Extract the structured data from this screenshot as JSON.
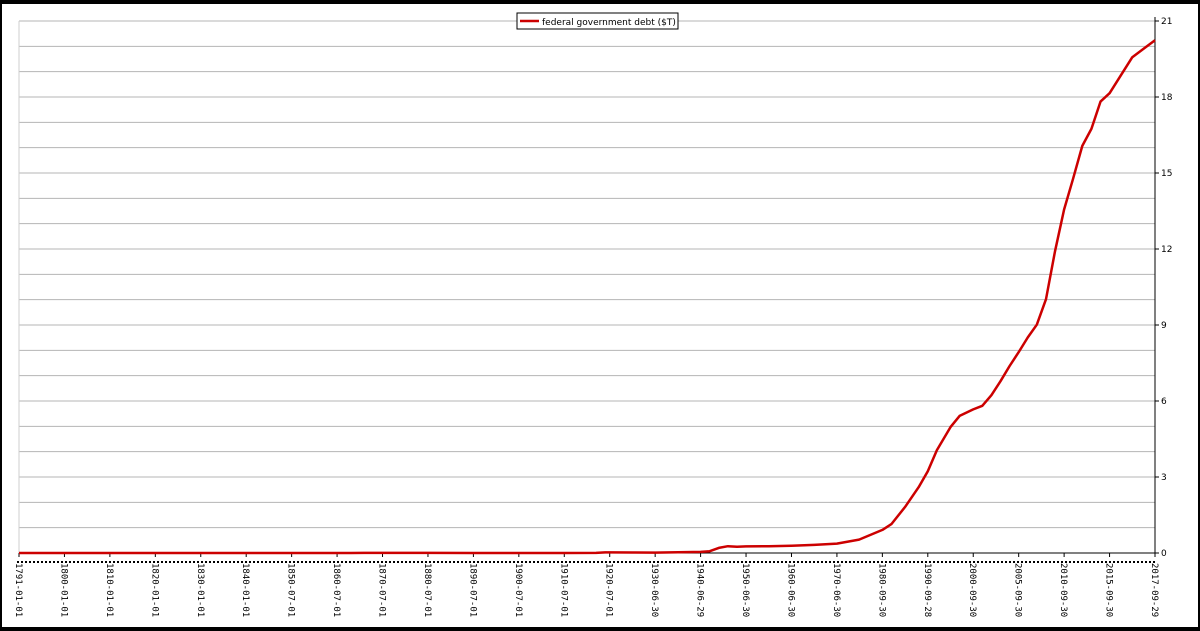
{
  "chart_data": {
    "type": "line",
    "title": "",
    "xlabel": "",
    "ylabel": "",
    "ylim": [
      0,
      21
    ],
    "yticks": [
      0,
      3,
      6,
      9,
      12,
      15,
      18,
      21
    ],
    "grid": true,
    "legend_position": "top-center",
    "x_tick_labels": [
      "1791-01-01",
      "1800-01-01",
      "1810-01-01",
      "1820-01-01",
      "1830-01-01",
      "1840-01-01",
      "1850-07-01",
      "1860-07-01",
      "1870-07-01",
      "1880-07-01",
      "1890-07-01",
      "1900-07-01",
      "1910-07-01",
      "1920-07-01",
      "1930-06-30",
      "1940-06-29",
      "1950-06-30",
      "1960-06-30",
      "1970-06-30",
      "1980-09-30",
      "1990-09-28",
      "2000-09-30",
      "2005-09-30",
      "2010-09-30",
      "2015-09-30",
      "2017-09-29"
    ],
    "series": [
      {
        "name": "federal government debt ($T)",
        "color": "#cc0000",
        "points": [
          [
            "1791-01-01",
            0.0001
          ],
          [
            "1800-01-01",
            0.0001
          ],
          [
            "1810-01-01",
            0.0001
          ],
          [
            "1820-01-01",
            0.0001
          ],
          [
            "1830-01-01",
            0.0001
          ],
          [
            "1840-01-01",
            0.0001
          ],
          [
            "1850-07-01",
            0.0001
          ],
          [
            "1860-07-01",
            0.0001
          ],
          [
            "1863-07-01",
            0.001
          ],
          [
            "1866-07-01",
            0.003
          ],
          [
            "1870-07-01",
            0.002
          ],
          [
            "1880-07-01",
            0.002
          ],
          [
            "1890-07-01",
            0.001
          ],
          [
            "1900-07-01",
            0.001
          ],
          [
            "1910-07-01",
            0.001
          ],
          [
            "1917-07-01",
            0.003
          ],
          [
            "1919-07-01",
            0.025
          ],
          [
            "1920-07-01",
            0.024
          ],
          [
            "1925-07-01",
            0.02
          ],
          [
            "1930-06-30",
            0.016
          ],
          [
            "1935-06-30",
            0.029
          ],
          [
            "1940-06-29",
            0.043
          ],
          [
            "1942-06-30",
            0.072
          ],
          [
            "1944-06-30",
            0.2
          ],
          [
            "1946-06-30",
            0.27
          ],
          [
            "1948-06-30",
            0.25
          ],
          [
            "1950-06-30",
            0.26
          ],
          [
            "1955-06-30",
            0.27
          ],
          [
            "1960-06-30",
            0.29
          ],
          [
            "1965-06-30",
            0.32
          ],
          [
            "1970-06-30",
            0.37
          ],
          [
            "1975-06-30",
            0.53
          ],
          [
            "1980-09-30",
            0.91
          ],
          [
            "1982-09-30",
            1.14
          ],
          [
            "1985-09-30",
            1.82
          ],
          [
            "1988-09-30",
            2.6
          ],
          [
            "1990-09-28",
            3.23
          ],
          [
            "1992-09-30",
            4.06
          ],
          [
            "1995-09-30",
            4.97
          ],
          [
            "1997-09-30",
            5.41
          ],
          [
            "2000-09-30",
            5.67
          ],
          [
            "2001-09-30",
            5.81
          ],
          [
            "2002-09-30",
            6.23
          ],
          [
            "2003-09-30",
            6.78
          ],
          [
            "2004-09-30",
            7.38
          ],
          [
            "2005-09-30",
            7.93
          ],
          [
            "2006-09-30",
            8.51
          ],
          [
            "2007-09-30",
            9.01
          ],
          [
            "2008-09-30",
            10.02
          ],
          [
            "2009-09-30",
            11.91
          ],
          [
            "2010-09-30",
            13.56
          ],
          [
            "2011-09-30",
            14.79
          ],
          [
            "2012-09-30",
            16.07
          ],
          [
            "2013-09-30",
            16.74
          ],
          [
            "2014-09-30",
            17.82
          ],
          [
            "2015-09-30",
            18.15
          ],
          [
            "2016-09-30",
            19.57
          ],
          [
            "2017-09-29",
            20.24
          ]
        ]
      }
    ]
  }
}
